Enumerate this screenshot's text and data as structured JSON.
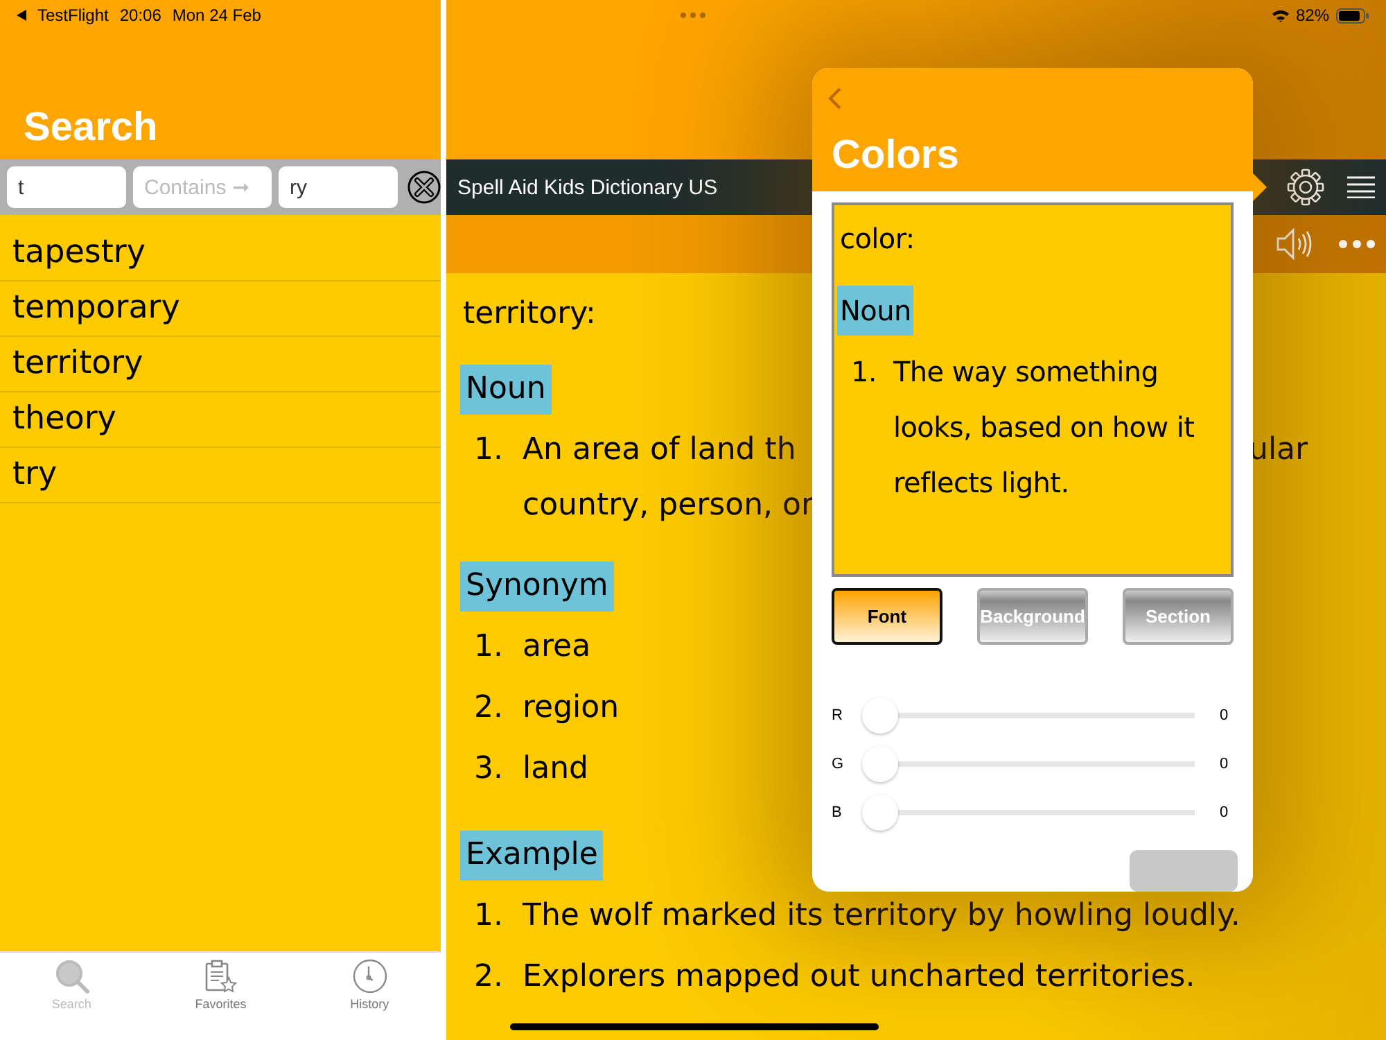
{
  "status_bar": {
    "back_app": "TestFlight",
    "time": "20:06",
    "date": "Mon 24 Feb",
    "battery": "82%"
  },
  "search_pane": {
    "title": "Search",
    "fields": [
      {
        "value": "t"
      },
      {
        "placeholder": "Contains ➞"
      },
      {
        "value": "ry"
      }
    ],
    "results": [
      "tapestry",
      "temporary",
      "territory",
      "theory",
      "try"
    ]
  },
  "tab_bar": [
    {
      "label": "Search",
      "selected": true
    },
    {
      "label": "Favorites",
      "selected": false
    },
    {
      "label": "History",
      "selected": false
    }
  ],
  "app_bar": {
    "title": "Spell Aid Kids Dictionary US"
  },
  "entry": {
    "headword": "territory:",
    "sections": [
      {
        "heading": "Noun",
        "items": [
          {
            "number": "1.",
            "lines": [
              {
                "text": "An area of land th",
                "tail": "ular"
              },
              {
                "text": "country, person, or"
              }
            ]
          }
        ]
      },
      {
        "heading": "Synonym",
        "items": [
          {
            "number": "1.",
            "lines": [
              {
                "text": "area"
              }
            ]
          },
          {
            "number": "2.",
            "lines": [
              {
                "text": "region"
              }
            ]
          },
          {
            "number": "3.",
            "lines": [
              {
                "text": "land"
              }
            ]
          }
        ]
      },
      {
        "heading": "Example",
        "items": [
          {
            "number": "1.",
            "lines": [
              {
                "text": "The wolf marked its territory by howling loudly."
              }
            ]
          },
          {
            "number": "2.",
            "lines": [
              {
                "text": "Explorers mapped out uncharted territories."
              }
            ]
          }
        ]
      }
    ]
  },
  "popover": {
    "title": "Colors",
    "preview": {
      "headword": "color:",
      "heading": "Noun",
      "number": "1.",
      "definition": "The way something looks, based on how it reflects light."
    },
    "targets": [
      {
        "label": "Font",
        "selected": true
      },
      {
        "label": "Background",
        "selected": false
      },
      {
        "label": "Section",
        "selected": false
      }
    ],
    "sliders": [
      {
        "label": "R",
        "level": 0,
        "reading": "0"
      },
      {
        "label": "G",
        "level": 0,
        "reading": "0"
      },
      {
        "label": "B",
        "level": 0,
        "reading": "0"
      }
    ]
  }
}
